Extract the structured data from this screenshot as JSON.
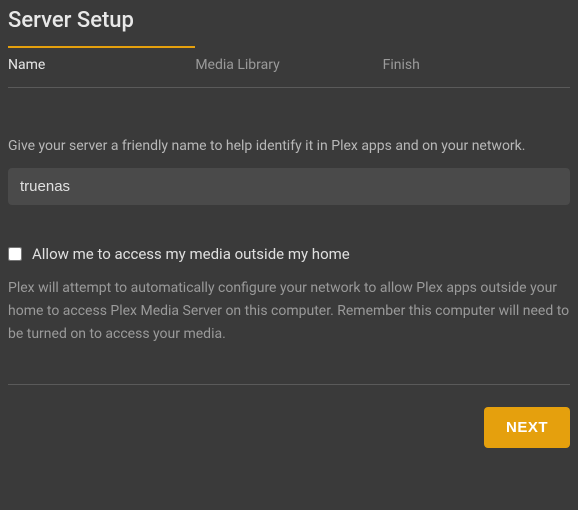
{
  "title": "Server Setup",
  "tabs": {
    "name": "Name",
    "library": "Media Library",
    "finish": "Finish"
  },
  "name_step": {
    "description": "Give your server a friendly name to help identify it in Plex apps and on your network.",
    "server_name_value": "truenas",
    "remote_access_label": "Allow me to access my media outside my home",
    "remote_access_checked": false,
    "remote_access_help": "Plex will attempt to automatically configure your network to allow Plex apps outside your home to access Plex Media Server on this computer. Remember this computer will need to be turned on to access your media."
  },
  "footer": {
    "next_label": "NEXT"
  },
  "colors": {
    "accent": "#e5a00d",
    "background": "#3a3a3a"
  }
}
